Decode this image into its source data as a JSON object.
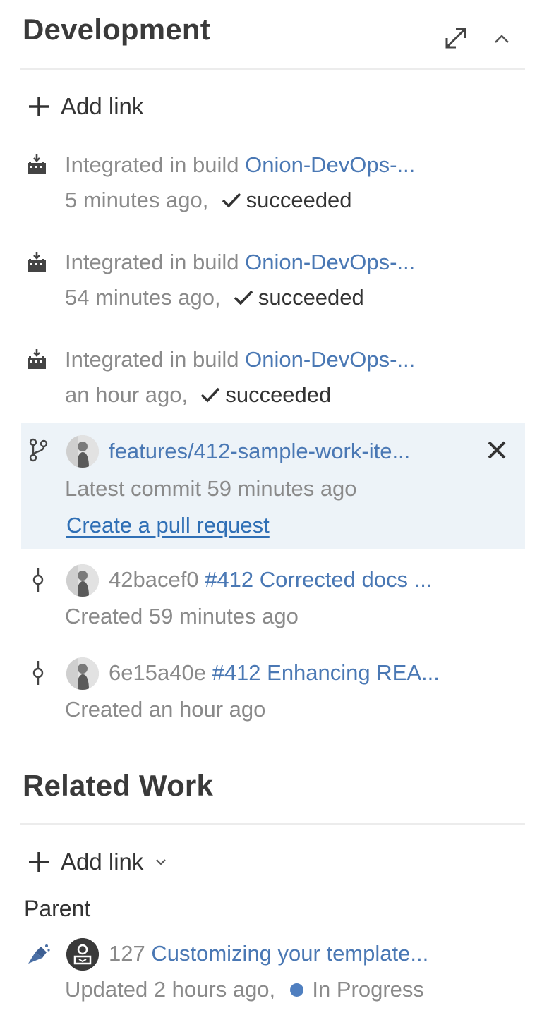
{
  "development": {
    "title": "Development",
    "expand_icon": "expand-diagonal-icon",
    "collapse_icon": "chevron-up-icon",
    "add_link_label": "Add link",
    "builds": [
      {
        "prefix": "Integrated in build",
        "build_name": "Onion-DevOps-...",
        "time": "5 minutes ago,",
        "status": "succeeded"
      },
      {
        "prefix": "Integrated in build",
        "build_name": "Onion-DevOps-...",
        "time": "54 minutes ago,",
        "status": "succeeded"
      },
      {
        "prefix": "Integrated in build",
        "build_name": "Onion-DevOps-...",
        "time": "an hour ago,",
        "status": "succeeded"
      }
    ],
    "branch": {
      "name": "features/412-sample-work-ite...",
      "latest_commit": "Latest commit 59 minutes ago",
      "pr_link": "Create a pull request"
    },
    "commits": [
      {
        "hash": "42bacef0",
        "message": "#412 Corrected docs ...",
        "created": "Created 59 minutes ago"
      },
      {
        "hash": "6e15a40e",
        "message": "#412 Enhancing REA...",
        "created": "Created an hour ago"
      }
    ]
  },
  "related_work": {
    "title": "Related Work",
    "add_link_label": "Add link",
    "parent_label": "Parent",
    "parent_item": {
      "id": "127",
      "title": "Customizing your template...",
      "updated": "Updated 2 hours ago,",
      "state": "In Progress"
    }
  },
  "colors": {
    "link": "#4a78b4",
    "muted_text": "#8a8a8a",
    "highlight_bg": "#edf3f8",
    "in_progress_dot": "#4f7fc0"
  }
}
